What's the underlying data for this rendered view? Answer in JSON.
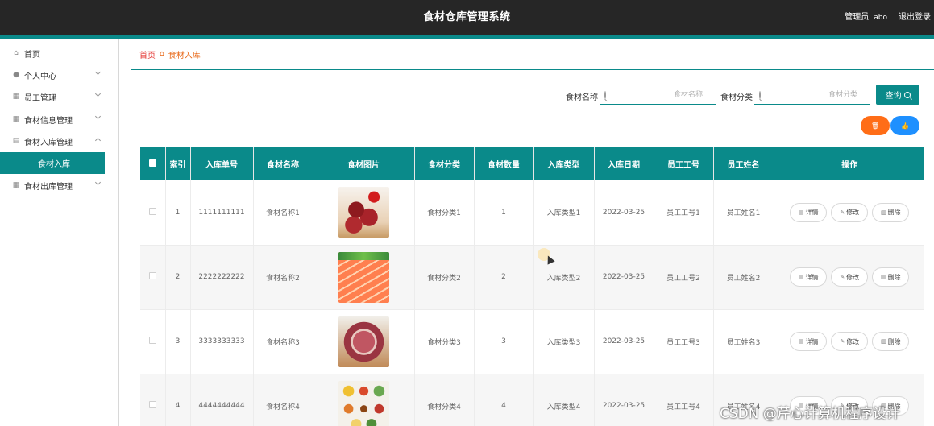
{
  "header": {
    "title": "食材仓库管理系统",
    "user_role": "管理员",
    "username": "abo",
    "logout_label": "退出登录"
  },
  "sidebar": {
    "items": [
      {
        "label": "首页",
        "icon": "home-icon",
        "expandable": false
      },
      {
        "label": "个人中心",
        "icon": "user-icon",
        "expandable": true
      },
      {
        "label": "员工管理",
        "icon": "grid-icon",
        "expandable": true
      },
      {
        "label": "食材信息管理",
        "icon": "grid-icon",
        "expandable": true
      },
      {
        "label": "食材入库管理",
        "icon": "clipboard-icon",
        "expandable": true
      },
      {
        "label": "食材出库管理",
        "icon": "grid-icon",
        "expandable": true
      }
    ],
    "active_sub": "食材入库"
  },
  "breadcrumb": {
    "home": "首页",
    "current": "食材入库"
  },
  "search": {
    "name_label": "食材名称",
    "name_placeholder": "食材名称",
    "category_label": "食材分类",
    "category_placeholder": "食材分类",
    "query_label": "查询"
  },
  "actions": {
    "delete_icon": "trash-icon",
    "add_icon": "thumb-icon"
  },
  "table": {
    "columns": [
      "",
      "索引",
      "入库单号",
      "食材名称",
      "食材图片",
      "食材分类",
      "食材数量",
      "入库类型",
      "入库日期",
      "员工工号",
      "员工姓名",
      "操作"
    ],
    "op_labels": {
      "detail": "详情",
      "edit": "修改",
      "delete": "删除"
    },
    "rows": [
      {
        "index": "1",
        "order_no": "1111111111",
        "name": "食材名称1",
        "image": "diced-beef-with-tomatoes",
        "category": "食材分类1",
        "quantity": "1",
        "type": "入库类型1",
        "date": "2022-03-25",
        "emp_no": "员工工号1",
        "emp_name": "员工姓名1"
      },
      {
        "index": "2",
        "order_no": "2222222222",
        "name": "食材名称2",
        "image": "salmon-slices",
        "category": "食材分类2",
        "quantity": "2",
        "type": "入库类型2",
        "date": "2022-03-25",
        "emp_no": "员工工号2",
        "emp_name": "员工姓名2"
      },
      {
        "index": "3",
        "order_no": "3333333333",
        "name": "食材名称3",
        "image": "raw-pork-cut",
        "category": "食材分类3",
        "quantity": "3",
        "type": "入库类型3",
        "date": "2022-03-25",
        "emp_no": "员工工号3",
        "emp_name": "员工姓名3"
      },
      {
        "index": "4",
        "order_no": "4444444444",
        "name": "食材名称4",
        "image": "spice-bowls",
        "category": "食材分类4",
        "quantity": "4",
        "type": "入库类型4",
        "date": "2022-03-25",
        "emp_no": "员工工号4",
        "emp_name": "员工姓名4"
      }
    ]
  },
  "watermark": "CSDN @芹心计算机程序设计",
  "colors": {
    "accent": "#0a8a8a",
    "header_bg": "#262626",
    "delete_btn": "#ff6d17",
    "add_btn": "#1e90ff",
    "breadcrumb_home": "#e53935",
    "breadcrumb_current": "#e86a1a"
  }
}
